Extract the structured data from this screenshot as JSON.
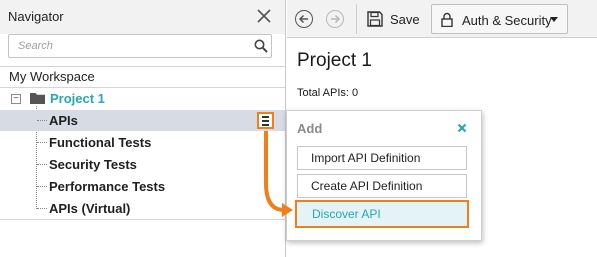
{
  "navigator": {
    "title": "Navigator",
    "search_placeholder": "Search",
    "workspace": "My Workspace",
    "project": {
      "label": "Project 1",
      "items": [
        {
          "label": "APIs",
          "selected": true
        },
        {
          "label": "Functional Tests"
        },
        {
          "label": "Security Tests"
        },
        {
          "label": "Performance Tests"
        },
        {
          "label": "APIs (Virtual)"
        }
      ]
    }
  },
  "toolbar": {
    "save_label": "Save",
    "auth_label": "Auth & Security"
  },
  "main": {
    "title": "Project 1",
    "total_apis": "Total APIs: 0"
  },
  "add_popup": {
    "title": "Add",
    "buttons": [
      {
        "label": "Import API Definition"
      },
      {
        "label": "Create API Definition"
      },
      {
        "label": "Discover API",
        "highlighted": true
      }
    ]
  },
  "colors": {
    "accent_teal": "#2aa6b3",
    "highlight_orange": "#f07f1a",
    "selected_row": "#d7dbe4"
  },
  "icons": [
    "close-icon",
    "search-icon",
    "folder-icon",
    "menu-icon",
    "back-icon",
    "forward-icon",
    "save-icon",
    "lock-icon",
    "chevron-down-icon",
    "arrow-icon"
  ]
}
